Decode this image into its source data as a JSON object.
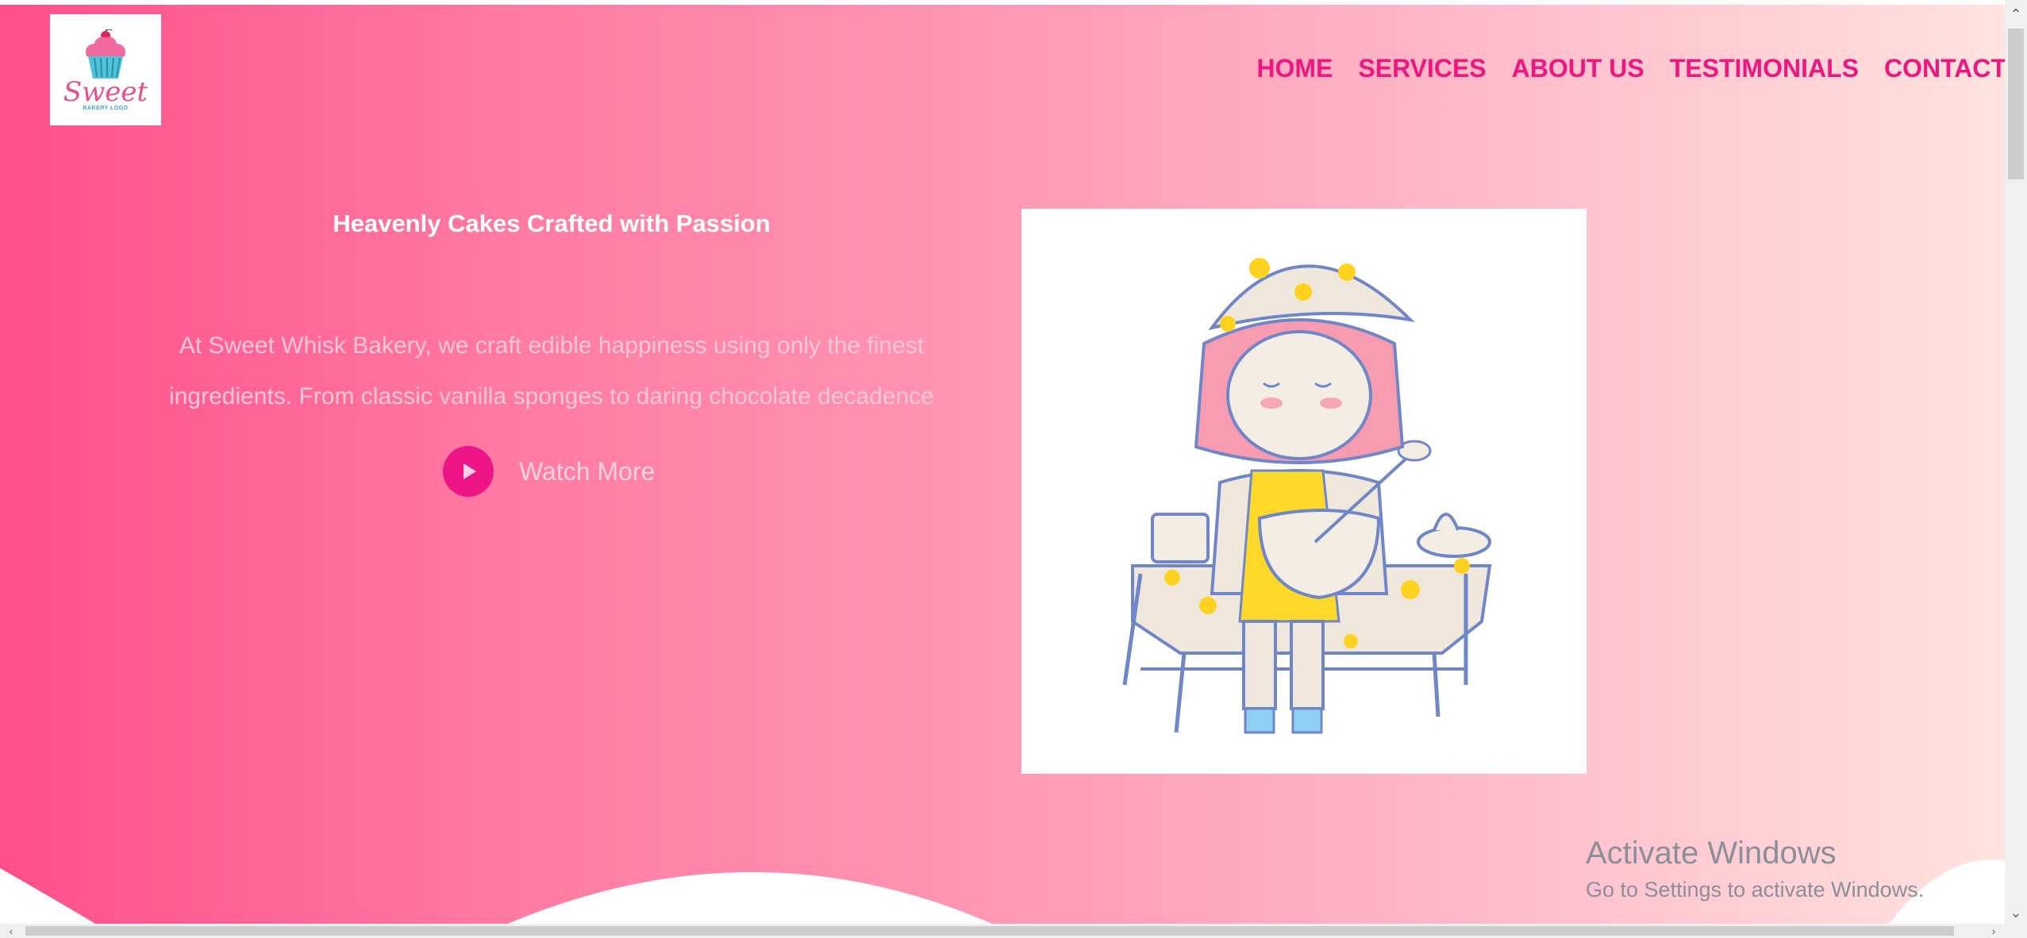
{
  "logo": {
    "script_text": "Sweet",
    "sub_text": "BAKERY LOGO"
  },
  "nav": {
    "items": [
      {
        "label": "HOME"
      },
      {
        "label": "SERVICES"
      },
      {
        "label": "ABOUT US"
      },
      {
        "label": "TESTIMONIALS"
      },
      {
        "label": "CONTACT"
      }
    ]
  },
  "hero": {
    "title": "Heavenly Cakes Crafted with Passion",
    "description_line1": "At Sweet Whisk Bakery, we craft edible happiness using only the finest",
    "description_line2": "ingredients. From classic vanilla sponges to daring chocolate decadence",
    "watch_label": "Watch More"
  },
  "watermark": {
    "title": "Activate Windows",
    "subtitle": "Go to Settings to activate Windows."
  },
  "colors": {
    "accent": "#f0157f",
    "gradient_start": "#ff4f8b",
    "gradient_end": "#ffe3df"
  },
  "icons": {
    "play": "play-icon",
    "scroll_up": "chevron-up-icon",
    "scroll_down": "chevron-down-icon",
    "scroll_left": "chevron-left-icon",
    "scroll_right": "chevron-right-icon"
  }
}
